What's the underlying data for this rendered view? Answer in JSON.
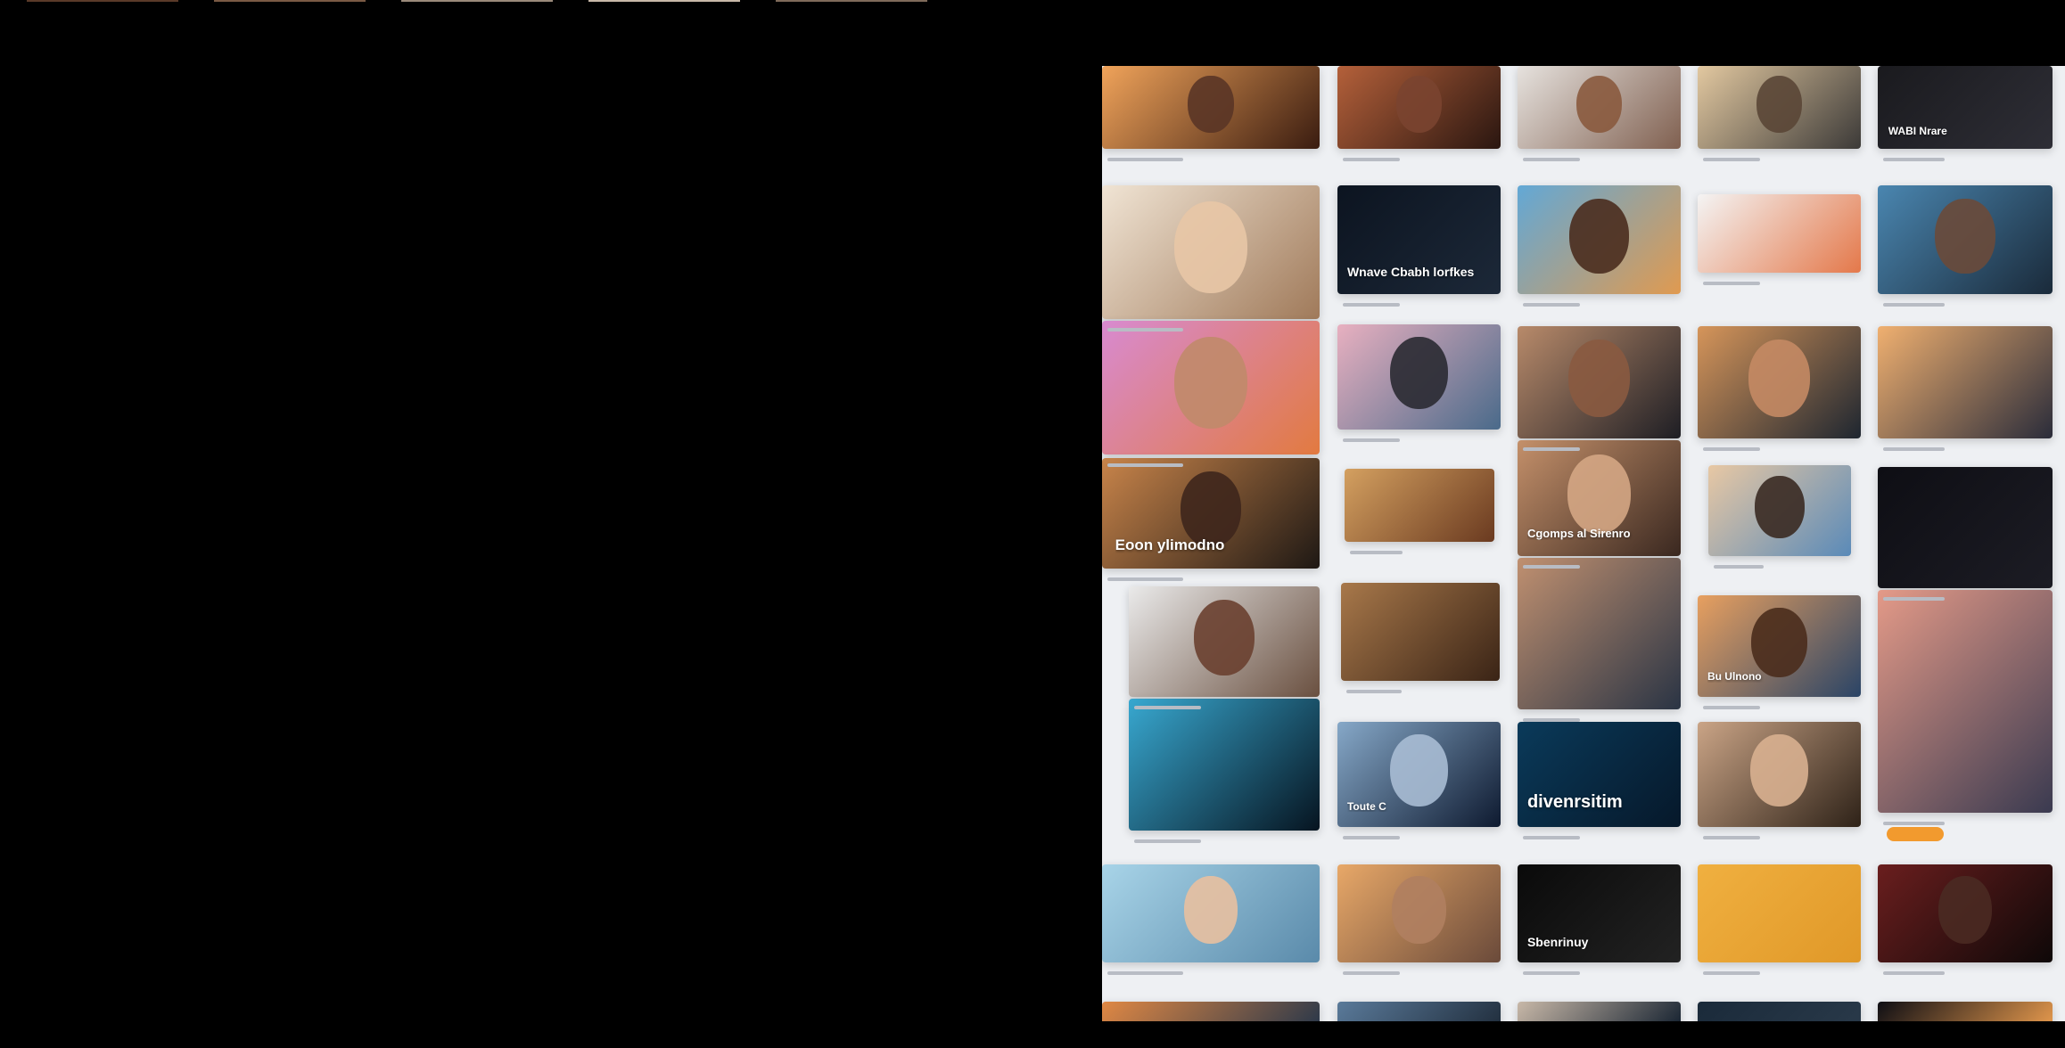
{
  "panel": {
    "background": "#eef0f3"
  },
  "top_strip_colors": [
    "#5a3a28",
    "#7a5a44",
    "#9a8a7a",
    "#c8b8a8",
    "#7f6a5a"
  ],
  "tiles": [
    {
      "name": "tile-portrait-man-orange",
      "bg": [
        "#f0a35a",
        "#3a1c10"
      ],
      "text": "",
      "size": 14,
      "face": "#5a3526"
    },
    {
      "name": "tile-woman-glasses",
      "bg": [
        "#b4603a",
        "#2a1610"
      ],
      "text": "",
      "size": 12,
      "face": "#7a4430"
    },
    {
      "name": "tile-woman-curly-hair",
      "bg": [
        "#e6e2de",
        "#806050"
      ],
      "text": "",
      "size": 12,
      "face": "#8a5a3e"
    },
    {
      "name": "tile-man-sunset",
      "bg": [
        "#e2c8a0",
        "#3c3a38"
      ],
      "text": "",
      "size": 12,
      "face": "#5a4636"
    },
    {
      "name": "tile-dark-title",
      "bg": [
        "#1a1a1e",
        "#2e2e36"
      ],
      "text": "WABI Nrare",
      "size": 12,
      "face": ""
    },
    {
      "name": "tile-interior-woman",
      "bg": [
        "#f0e4d4",
        "#a07a5a"
      ],
      "text": "",
      "size": 12,
      "face": "#e8c6a6"
    },
    {
      "name": "tile-dark-event",
      "bg": [
        "#0c1420",
        "#1c2838"
      ],
      "text": "Wnave Cbabh lorfkes",
      "size": 14,
      "face": ""
    },
    {
      "name": "tile-woman-afro-blue",
      "bg": [
        "#62a8d6",
        "#e09a50"
      ],
      "text": "",
      "size": 12,
      "face": "#4a2c1e"
    },
    {
      "name": "tile-form-orange",
      "bg": [
        "#f4f4f4",
        "#e4784a"
      ],
      "text": "",
      "size": 12,
      "face": ""
    },
    {
      "name": "tile-man-blue",
      "bg": [
        "#4a86b0",
        "#1a2a3a"
      ],
      "text": "",
      "size": 12,
      "face": "#6a4a3a"
    },
    {
      "name": "tile-old-man-colorful",
      "bg": [
        "#d88ad0",
        "#e27a40"
      ],
      "text": "",
      "size": 12,
      "face": "#c08a6a"
    },
    {
      "name": "tile-figure-pink-sky",
      "bg": [
        "#e8b0c0",
        "#4a6a8a"
      ],
      "text": "",
      "size": 12,
      "face": "#2a2a32"
    },
    {
      "name": "tile-woman-dark-jacket",
      "bg": [
        "#b88a6a",
        "#1e1e24"
      ],
      "text": "",
      "size": 12,
      "face": "#8a5a40"
    },
    {
      "name": "tile-woman-warm-room",
      "bg": [
        "#d6955a",
        "#1e2630"
      ],
      "text": "",
      "size": 12,
      "face": "#c48a64"
    },
    {
      "name": "tile-sunset-landscape",
      "bg": [
        "#f0b070",
        "#2a2c3a"
      ],
      "text": "",
      "size": 12,
      "face": ""
    },
    {
      "name": "tile-woman-banner",
      "bg": [
        "#c8844a",
        "#1e1814"
      ],
      "text": "Eoon ylimodno",
      "size": 17,
      "face": "#3e261c"
    },
    {
      "name": "tile-collage-people",
      "bg": [
        "#d4a060",
        "#6a3a20"
      ],
      "text": "",
      "size": 12,
      "face": ""
    },
    {
      "name": "tile-woman-closeup",
      "bg": [
        "#c4906a",
        "#3a2820"
      ],
      "text": "Cgomps al Sirenro",
      "size": 13,
      "face": "#d4a684"
    },
    {
      "name": "tile-boy-tower",
      "bg": [
        "#e8c8a4",
        "#5a8ab8"
      ],
      "text": "",
      "size": 12,
      "face": "#3a2a22"
    },
    {
      "name": "tile-dark-text",
      "bg": [
        "#0e0e14",
        "#1c1c24"
      ],
      "text": "",
      "size": 12,
      "face": ""
    },
    {
      "name": "tile-woman-grey-top",
      "bg": [
        "#eaeaea",
        "#6a5040"
      ],
      "text": "",
      "size": 12,
      "face": "#6a4030"
    },
    {
      "name": "tile-collage-warm",
      "bg": [
        "#a8784a",
        "#3a2416"
      ],
      "text": "",
      "size": 12,
      "face": ""
    },
    {
      "name": "tile-city-dusk",
      "bg": [
        "#c09070",
        "#2a3444"
      ],
      "text": "",
      "size": 12,
      "face": ""
    },
    {
      "name": "tile-man-portrait-city",
      "bg": [
        "#e8a060",
        "#2a4466"
      ],
      "text": "Bu Ulnono",
      "size": 12,
      "face": "#4a2c1c"
    },
    {
      "name": "tile-tall-city",
      "bg": [
        "#e49a88",
        "#3a3a50"
      ],
      "text": "",
      "size": 12,
      "face": ""
    },
    {
      "name": "tile-blue-skyline",
      "bg": [
        "#38a8d0",
        "#061420"
      ],
      "text": "",
      "size": 12,
      "face": ""
    },
    {
      "name": "tile-face-blue",
      "bg": [
        "#86a8c8",
        "#0e1a30"
      ],
      "text": "Toute C",
      "size": 12,
      "face": "#a8bcd4"
    },
    {
      "name": "tile-diversity",
      "bg": [
        "#0a3a5a",
        "#06182a"
      ],
      "text": "divenrsitim",
      "size": 20,
      "face": ""
    },
    {
      "name": "tile-woman-dark-hair",
      "bg": [
        "#caa486",
        "#2e2218"
      ],
      "text": "",
      "size": 12,
      "face": "#d8b090"
    },
    {
      "name": "tile-man-blue-shirt",
      "bg": [
        "#a8d4e8",
        "#5a8aaa"
      ],
      "text": "",
      "size": 12,
      "face": "#e8c0a0"
    },
    {
      "name": "tile-hug-orange",
      "bg": [
        "#e8a868",
        "#6a4a3a"
      ],
      "text": "",
      "size": 12,
      "face": "#b08060"
    },
    {
      "name": "tile-dark-typography",
      "bg": [
        "#0a0a0a",
        "#222"
      ],
      "text": "Sbenrinuy",
      "size": 14,
      "face": ""
    },
    {
      "name": "tile-yellow-card",
      "bg": [
        "#f0b040",
        "#e09828"
      ],
      "text": "",
      "size": 12,
      "face": ""
    },
    {
      "name": "tile-dark-red-scene",
      "bg": [
        "#6a1e1e",
        "#0e0808"
      ],
      "text": "",
      "size": 12,
      "face": "#4a2a22"
    },
    {
      "name": "tile-bottom-1",
      "bg": [
        "#e08844",
        "#22344a"
      ],
      "text": "",
      "size": 12,
      "face": ""
    },
    {
      "name": "tile-bottom-2",
      "bg": [
        "#5a7a9a",
        "#1e2a38"
      ],
      "text": "",
      "size": 12,
      "face": ""
    },
    {
      "name": "tile-bottom-3",
      "bg": [
        "#c8b8a8",
        "#0c1a2a"
      ],
      "text": "",
      "size": 12,
      "face": ""
    },
    {
      "name": "tile-bottom-4",
      "bg": [
        "#1a2a3a",
        "#2a3a4a"
      ],
      "text": "",
      "size": 12,
      "face": ""
    },
    {
      "name": "tile-bottom-5",
      "bg": [
        "#0e0e14",
        "#f0a050"
      ],
      "text": "",
      "size": 12,
      "face": ""
    }
  ],
  "buttons": [
    {
      "name": "orange-pill-button",
      "text": ""
    }
  ],
  "captions": []
}
